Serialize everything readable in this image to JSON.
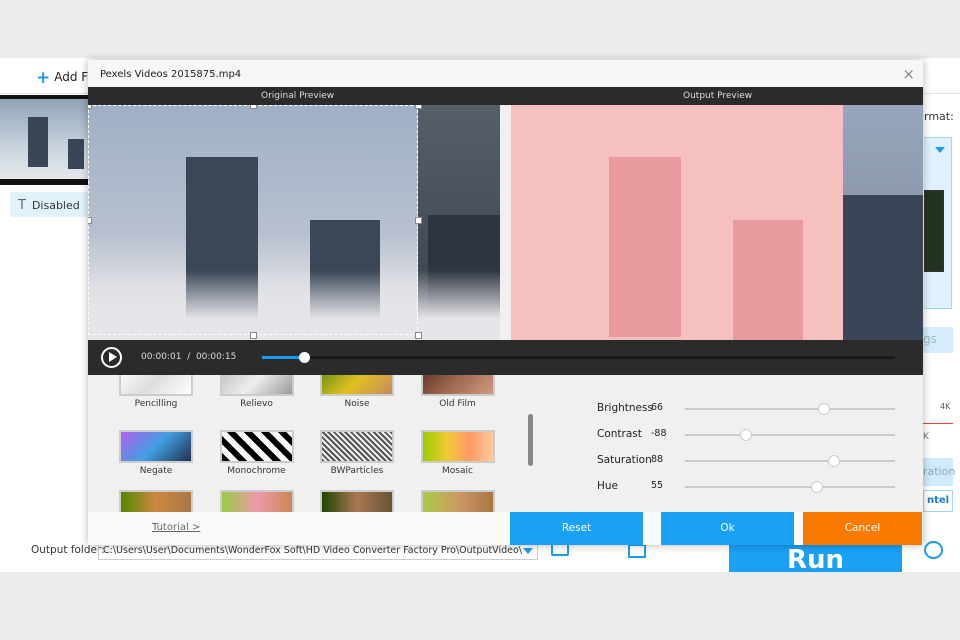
{
  "background_app": {
    "add_files_label": "Add Fi",
    "subtitle_button": "Disabled",
    "format_label": "rmat:",
    "settings_fragment": "gs",
    "quality_label": "4K",
    "quality_sub": "K",
    "acceleration_fragment": "ration",
    "intel_fragment": "ntel",
    "output_folder_label": "Output folder:",
    "output_folder_value": "C:\\Users\\User\\Documents\\WonderFox Soft\\HD Video Converter Factory Pro\\OutputVideo\\",
    "run_label": "Run"
  },
  "dialog": {
    "title": "Pexels Videos 2015875.mp4",
    "close": "×",
    "original_preview": "Original Preview",
    "output_preview": "Output Preview",
    "current_time": "00:00:01",
    "separator": "/",
    "total_time": "00:00:15",
    "progress_fraction": 0.067,
    "effects": [
      {
        "label": "Pencilling"
      },
      {
        "label": "Relievo"
      },
      {
        "label": "Noise"
      },
      {
        "label": "Old Film"
      },
      {
        "label": "Negate"
      },
      {
        "label": "Monochrome"
      },
      {
        "label": "BWParticles"
      },
      {
        "label": "Mosaic"
      },
      {
        "label": ""
      },
      {
        "label": ""
      },
      {
        "label": ""
      },
      {
        "label": ""
      }
    ],
    "adjustments": [
      {
        "label": "Brightness",
        "value": "66",
        "pos": 0.66
      },
      {
        "label": "Contrast",
        "value": "-88",
        "pos": 0.29
      },
      {
        "label": "Saturation",
        "value": "88",
        "pos": 0.71
      },
      {
        "label": "Hue",
        "value": "55",
        "pos": 0.63
      }
    ],
    "tutorial": "Tutorial >",
    "reset": "Reset",
    "ok": "Ok",
    "cancel": "Cancel"
  },
  "colors": {
    "accent": "#1aa0f5",
    "cancel": "#f97a00",
    "dark": "#2b2b2b"
  }
}
